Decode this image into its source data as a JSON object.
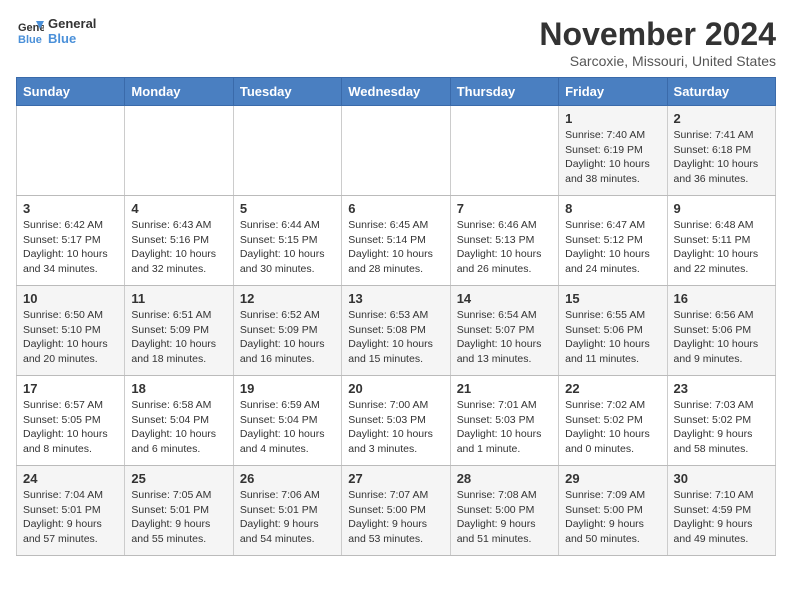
{
  "header": {
    "logo_line1": "General",
    "logo_line2": "Blue",
    "month": "November 2024",
    "location": "Sarcoxie, Missouri, United States"
  },
  "weekdays": [
    "Sunday",
    "Monday",
    "Tuesday",
    "Wednesday",
    "Thursday",
    "Friday",
    "Saturday"
  ],
  "weeks": [
    [
      {
        "day": "",
        "info": ""
      },
      {
        "day": "",
        "info": ""
      },
      {
        "day": "",
        "info": ""
      },
      {
        "day": "",
        "info": ""
      },
      {
        "day": "",
        "info": ""
      },
      {
        "day": "1",
        "info": "Sunrise: 7:40 AM\nSunset: 6:19 PM\nDaylight: 10 hours\nand 38 minutes."
      },
      {
        "day": "2",
        "info": "Sunrise: 7:41 AM\nSunset: 6:18 PM\nDaylight: 10 hours\nand 36 minutes."
      }
    ],
    [
      {
        "day": "3",
        "info": "Sunrise: 6:42 AM\nSunset: 5:17 PM\nDaylight: 10 hours\nand 34 minutes."
      },
      {
        "day": "4",
        "info": "Sunrise: 6:43 AM\nSunset: 5:16 PM\nDaylight: 10 hours\nand 32 minutes."
      },
      {
        "day": "5",
        "info": "Sunrise: 6:44 AM\nSunset: 5:15 PM\nDaylight: 10 hours\nand 30 minutes."
      },
      {
        "day": "6",
        "info": "Sunrise: 6:45 AM\nSunset: 5:14 PM\nDaylight: 10 hours\nand 28 minutes."
      },
      {
        "day": "7",
        "info": "Sunrise: 6:46 AM\nSunset: 5:13 PM\nDaylight: 10 hours\nand 26 minutes."
      },
      {
        "day": "8",
        "info": "Sunrise: 6:47 AM\nSunset: 5:12 PM\nDaylight: 10 hours\nand 24 minutes."
      },
      {
        "day": "9",
        "info": "Sunrise: 6:48 AM\nSunset: 5:11 PM\nDaylight: 10 hours\nand 22 minutes."
      }
    ],
    [
      {
        "day": "10",
        "info": "Sunrise: 6:50 AM\nSunset: 5:10 PM\nDaylight: 10 hours\nand 20 minutes."
      },
      {
        "day": "11",
        "info": "Sunrise: 6:51 AM\nSunset: 5:09 PM\nDaylight: 10 hours\nand 18 minutes."
      },
      {
        "day": "12",
        "info": "Sunrise: 6:52 AM\nSunset: 5:09 PM\nDaylight: 10 hours\nand 16 minutes."
      },
      {
        "day": "13",
        "info": "Sunrise: 6:53 AM\nSunset: 5:08 PM\nDaylight: 10 hours\nand 15 minutes."
      },
      {
        "day": "14",
        "info": "Sunrise: 6:54 AM\nSunset: 5:07 PM\nDaylight: 10 hours\nand 13 minutes."
      },
      {
        "day": "15",
        "info": "Sunrise: 6:55 AM\nSunset: 5:06 PM\nDaylight: 10 hours\nand 11 minutes."
      },
      {
        "day": "16",
        "info": "Sunrise: 6:56 AM\nSunset: 5:06 PM\nDaylight: 10 hours\nand 9 minutes."
      }
    ],
    [
      {
        "day": "17",
        "info": "Sunrise: 6:57 AM\nSunset: 5:05 PM\nDaylight: 10 hours\nand 8 minutes."
      },
      {
        "day": "18",
        "info": "Sunrise: 6:58 AM\nSunset: 5:04 PM\nDaylight: 10 hours\nand 6 minutes."
      },
      {
        "day": "19",
        "info": "Sunrise: 6:59 AM\nSunset: 5:04 PM\nDaylight: 10 hours\nand 4 minutes."
      },
      {
        "day": "20",
        "info": "Sunrise: 7:00 AM\nSunset: 5:03 PM\nDaylight: 10 hours\nand 3 minutes."
      },
      {
        "day": "21",
        "info": "Sunrise: 7:01 AM\nSunset: 5:03 PM\nDaylight: 10 hours\nand 1 minute."
      },
      {
        "day": "22",
        "info": "Sunrise: 7:02 AM\nSunset: 5:02 PM\nDaylight: 10 hours\nand 0 minutes."
      },
      {
        "day": "23",
        "info": "Sunrise: 7:03 AM\nSunset: 5:02 PM\nDaylight: 9 hours\nand 58 minutes."
      }
    ],
    [
      {
        "day": "24",
        "info": "Sunrise: 7:04 AM\nSunset: 5:01 PM\nDaylight: 9 hours\nand 57 minutes."
      },
      {
        "day": "25",
        "info": "Sunrise: 7:05 AM\nSunset: 5:01 PM\nDaylight: 9 hours\nand 55 minutes."
      },
      {
        "day": "26",
        "info": "Sunrise: 7:06 AM\nSunset: 5:01 PM\nDaylight: 9 hours\nand 54 minutes."
      },
      {
        "day": "27",
        "info": "Sunrise: 7:07 AM\nSunset: 5:00 PM\nDaylight: 9 hours\nand 53 minutes."
      },
      {
        "day": "28",
        "info": "Sunrise: 7:08 AM\nSunset: 5:00 PM\nDaylight: 9 hours\nand 51 minutes."
      },
      {
        "day": "29",
        "info": "Sunrise: 7:09 AM\nSunset: 5:00 PM\nDaylight: 9 hours\nand 50 minutes."
      },
      {
        "day": "30",
        "info": "Sunrise: 7:10 AM\nSunset: 4:59 PM\nDaylight: 9 hours\nand 49 minutes."
      }
    ]
  ]
}
